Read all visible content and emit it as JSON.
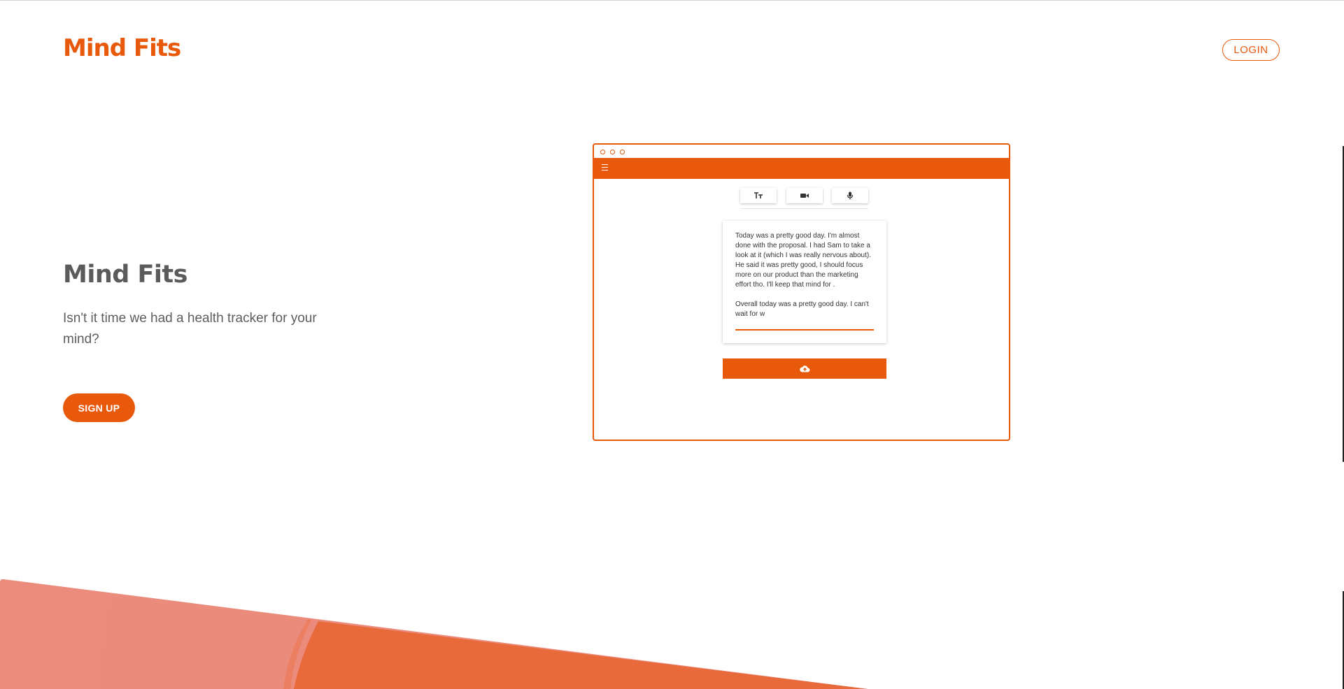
{
  "header": {
    "brand": "Mind Fits",
    "login_label": "LOGIN"
  },
  "hero": {
    "title": "Mind Fits",
    "subtitle": "Isn't it time we had a health tracker for your mind?",
    "signup_label": "SIGN UP"
  },
  "mockup": {
    "toolbar": {
      "icons": [
        "text-size-icon",
        "video-camera-icon",
        "microphone-icon"
      ]
    },
    "entry_text": "Today was a pretty good day. I'm almost done with the proposal. I had Sam to take a look at it (which I was really nervous about). He said it was pretty good, I should focus more on our product than the marketing effort tho. I'll keep that mind for .\n\nOverall today was a pretty good day. I can't wait for w",
    "upload_icon": "cloud-upload-icon"
  },
  "colors": {
    "accent": "#e8590c",
    "wave_light": "#eb8b7b",
    "wave_dark": "#e8693a"
  }
}
